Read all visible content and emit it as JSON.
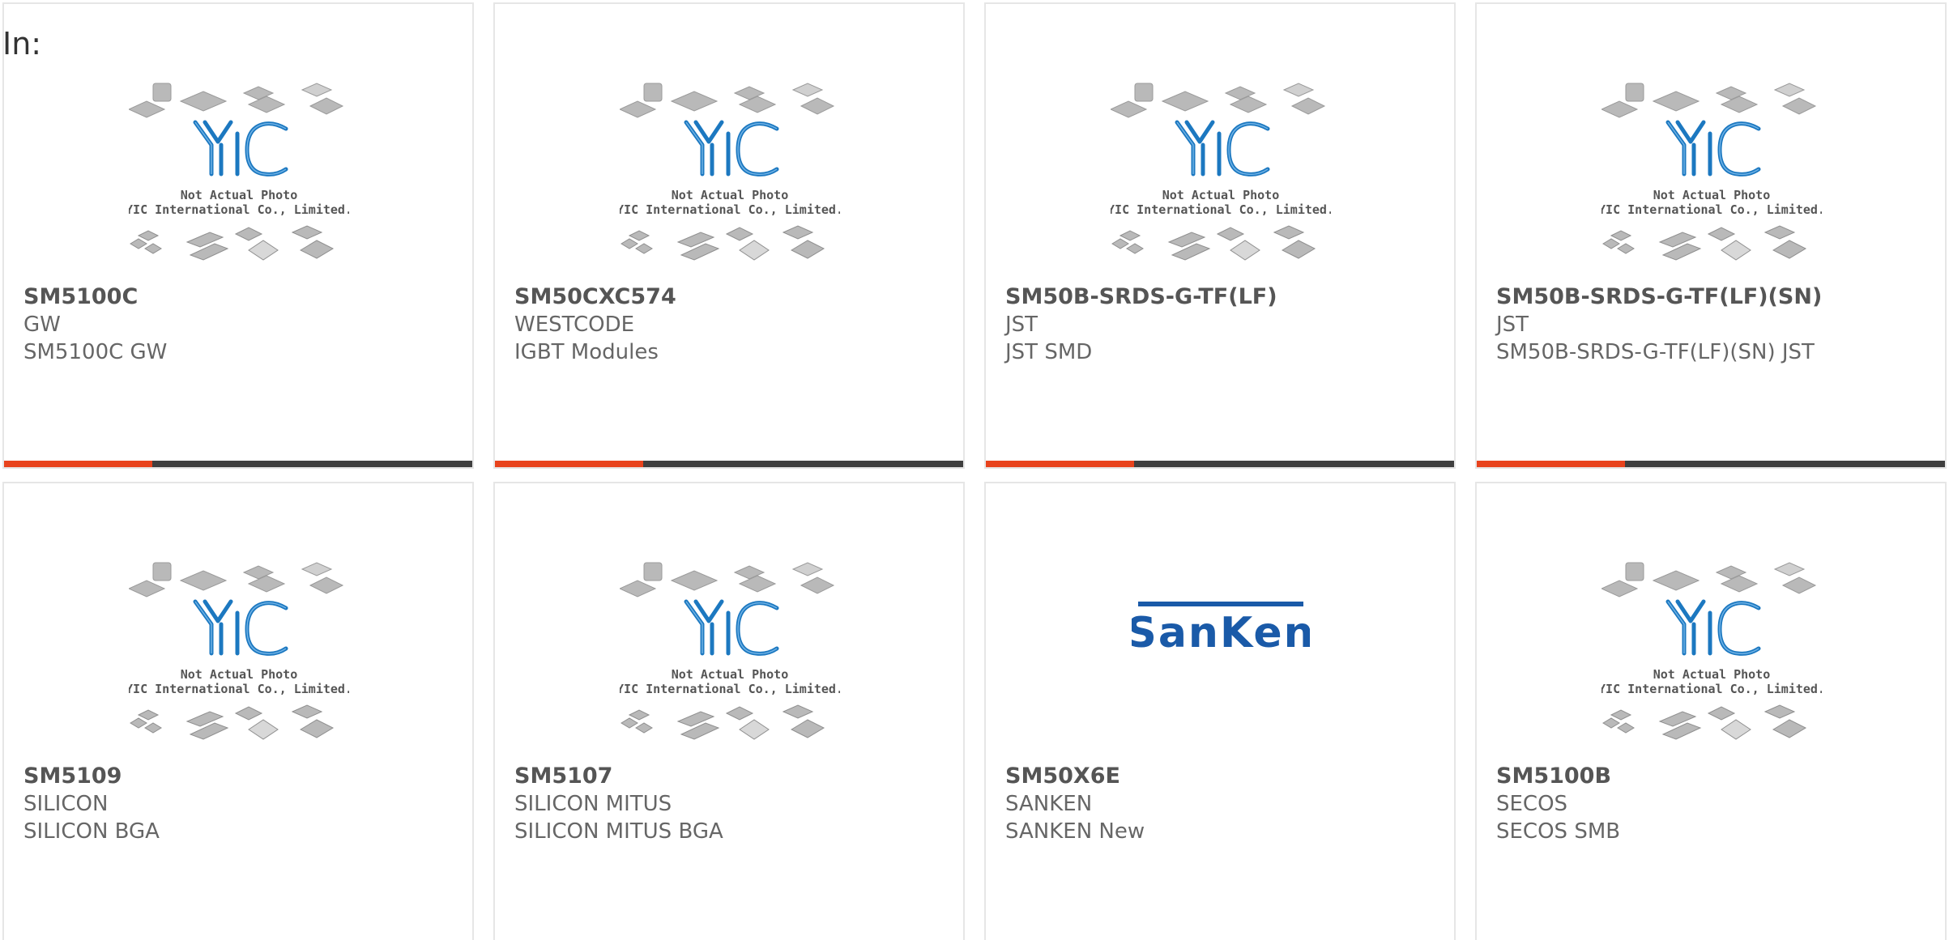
{
  "filter_label": "In:",
  "placeholder": {
    "line1": "Not Actual Photo",
    "line2": "YIC International Co., Limited."
  },
  "brand_colors": {
    "accent": "#e8431d",
    "dark": "#3f3f3f",
    "yic_blue": "#1c78c0",
    "sanken_blue": "#1a5aa8"
  },
  "products": [
    {
      "part": "SM5100C",
      "maker": "GW",
      "desc": "SM5100C GW",
      "image": "yic-placeholder"
    },
    {
      "part": "SM50CXC574",
      "maker": "WESTCODE",
      "desc": "IGBT Modules",
      "image": "yic-placeholder"
    },
    {
      "part": "SM50B-SRDS-G-TF(LF)",
      "maker": "JST",
      "desc": "JST SMD",
      "image": "yic-placeholder"
    },
    {
      "part": "SM50B-SRDS-G-TF(LF)(SN)",
      "maker": "JST",
      "desc": "SM50B-SRDS-G-TF(LF)(SN) JST",
      "image": "yic-placeholder"
    },
    {
      "part": "SM5109",
      "maker": "SILICON",
      "desc": "SILICON BGA",
      "image": "yic-placeholder"
    },
    {
      "part": "SM5107",
      "maker": "SILICON MITUS",
      "desc": "SILICON MITUS BGA",
      "image": "yic-placeholder"
    },
    {
      "part": "SM50X6E",
      "maker": "SANKEN",
      "desc": "SANKEN New",
      "image": "sanken-logo",
      "logo_text": "SanKen"
    },
    {
      "part": "SM5100B",
      "maker": "SECOS",
      "desc": "SECOS SMB",
      "image": "yic-placeholder"
    }
  ]
}
